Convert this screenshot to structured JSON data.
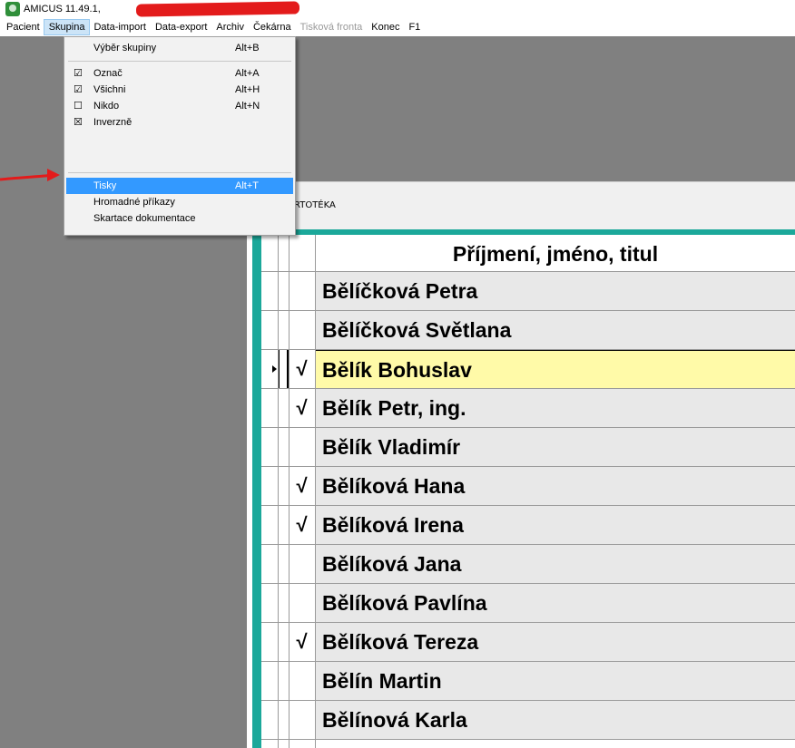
{
  "titlebar": {
    "title": "AMICUS 11.49.1,"
  },
  "menubar": {
    "items": [
      {
        "label": "Pacient"
      },
      {
        "label": "Skupina"
      },
      {
        "label": "Data-import"
      },
      {
        "label": "Data-export"
      },
      {
        "label": "Archiv"
      },
      {
        "label": "Čekárna"
      },
      {
        "label": "Tisková fronta"
      },
      {
        "label": "Konec"
      },
      {
        "label": "F1"
      }
    ]
  },
  "dropdown": {
    "items": [
      {
        "label": "Výběr skupiny",
        "shortcut": "Alt+B"
      },
      {
        "label": "Označ",
        "shortcut": "Alt+A"
      },
      {
        "label": "Všichni",
        "shortcut": "Alt+H"
      },
      {
        "label": "Nikdo",
        "shortcut": "Alt+N"
      },
      {
        "label": "Inverzně",
        "shortcut": ""
      },
      {
        "label": "Tisky",
        "shortcut": "Alt+T"
      },
      {
        "label": "Hromadné příkazy",
        "shortcut": ""
      },
      {
        "label": "Skartace dokumentace",
        "shortcut": ""
      }
    ]
  },
  "child_window": {
    "title": "RTOTÉKA"
  },
  "grid": {
    "header": "Příjmení, jméno, titul",
    "rows": [
      {
        "name": "Bělíčková Petra",
        "mark": ""
      },
      {
        "name": "Bělíčková Světlana",
        "mark": ""
      },
      {
        "name": "Bělík Bohuslav",
        "mark": "√"
      },
      {
        "name": "Bělík Petr, ing.",
        "mark": "√"
      },
      {
        "name": "Bělík Vladimír",
        "mark": ""
      },
      {
        "name": "Bělíková Hana",
        "mark": "√"
      },
      {
        "name": "Bělíková Irena",
        "mark": "√"
      },
      {
        "name": "Bělíková Jana",
        "mark": ""
      },
      {
        "name": "Bělíková Pavlína",
        "mark": ""
      },
      {
        "name": "Bělíková Tereza",
        "mark": "√"
      },
      {
        "name": "Bělín Martin",
        "mark": ""
      },
      {
        "name": "Bělínová Karla",
        "mark": ""
      }
    ]
  },
  "colors": {
    "workspace": "#808080",
    "teal": "#1ba89a",
    "selected_row": "#fffaa8",
    "menu_highlight": "#3399ff",
    "annotation_arrow": "#e31b1b"
  }
}
